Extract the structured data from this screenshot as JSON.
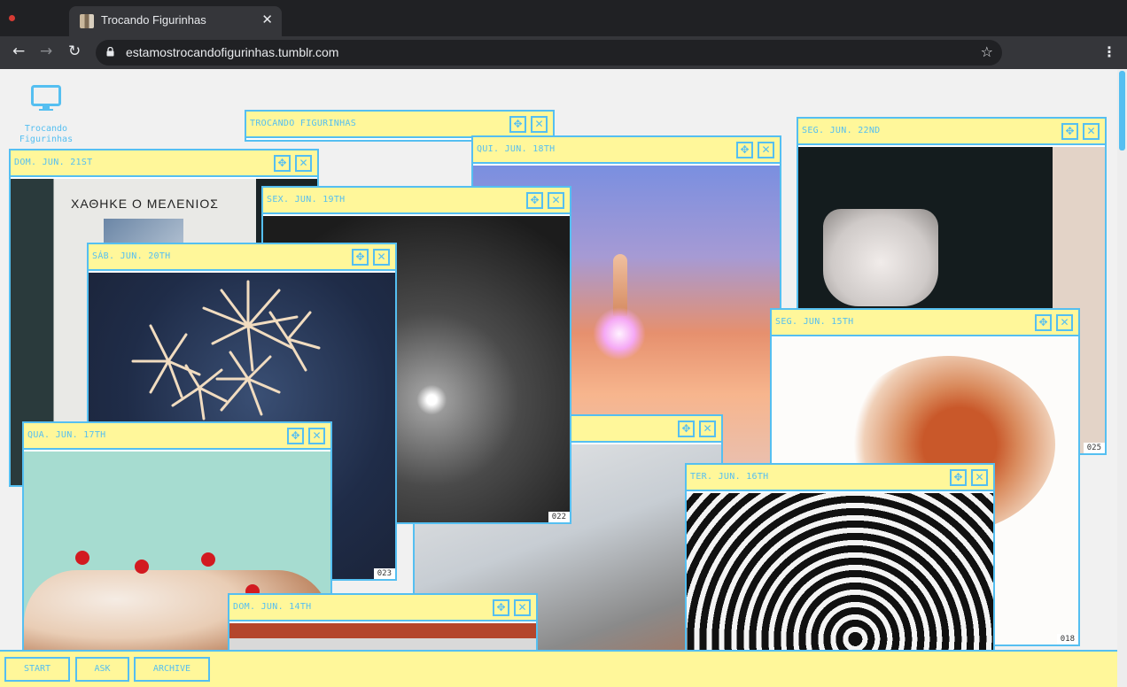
{
  "browser": {
    "tab_title": "Trocando Figurinhas",
    "tab_close": "✕",
    "url": "estamostrocandofigurinhas.tumblr.com",
    "back": "←",
    "forward": "→",
    "reload": "↻",
    "star": "☆",
    "menu": "⋮"
  },
  "desktop": {
    "icon_label_line1": "Trocando",
    "icon_label_line2": "Figurinhas",
    "icon": "monitor-icon"
  },
  "windows": {
    "header": {
      "title": "TROCANDO FIGURINHAS"
    },
    "jun21": {
      "title": "DOM. JUN. 21ST",
      "caption": "ΧΑΘΗΚΕ Ο ΜΕΛΕΝΙΟΣ"
    },
    "jun18": {
      "title": "QUI. JUN. 18TH"
    },
    "jun22": {
      "title": "SEG. JUN. 22ND",
      "number": "025"
    },
    "jun19": {
      "title": "SEX. JUN. 19TH",
      "number": "022"
    },
    "jun20": {
      "title": "SÁB. JUN. 20TH",
      "number": "023"
    },
    "jun15": {
      "title": "SEG. JUN. 15TH",
      "number": "018"
    },
    "unnamed": {
      "title": ""
    },
    "jun17": {
      "title": "QUA. JUN. 17TH"
    },
    "jun16": {
      "title": "TER. JUN. 16TH"
    },
    "jun14": {
      "title": "DOM. JUN. 14TH"
    }
  },
  "window_controls": {
    "move": "✥",
    "close": "✕"
  },
  "taskbar": {
    "start": "START",
    "ask": "ASK",
    "archive": "ARCHIVE"
  },
  "colors": {
    "accent": "#55bff1",
    "titlebar": "#fff79a",
    "chrome_dark": "#202124",
    "chrome_toolbar": "#35363a"
  }
}
